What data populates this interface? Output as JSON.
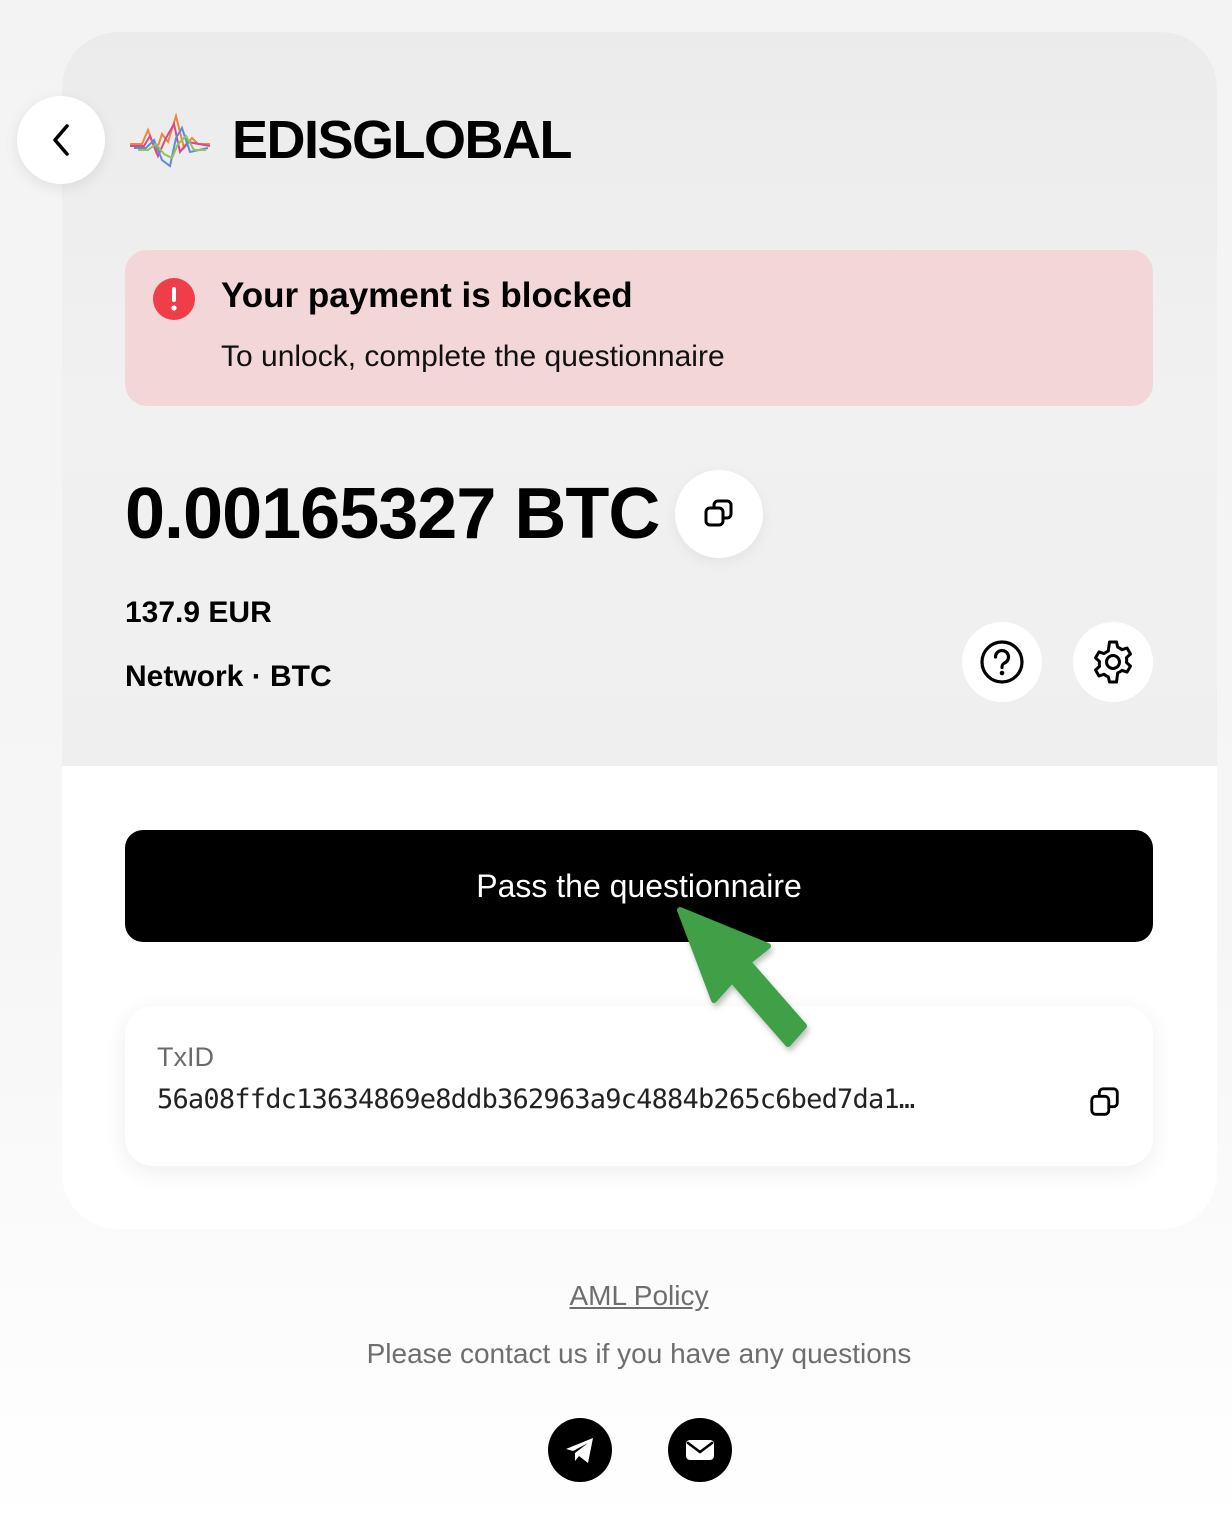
{
  "header": {
    "brand": "EDISGLOBAL",
    "back_icon": "chevron-left-icon",
    "logo_icon": "waveform-logo-icon"
  },
  "alert": {
    "title": "Your payment is blocked",
    "message": "To unlock, complete the questionnaire",
    "icon": "exclamation-circle-icon",
    "color": "#ef3d4a",
    "background": "#f2d6d8"
  },
  "payment": {
    "amount": "0.00165327 BTC",
    "fiat": "137.9 EUR",
    "network": "Network · BTC",
    "copy_icon": "copy-icon",
    "help_icon": "question-circle-icon",
    "settings_icon": "gear-icon"
  },
  "actions": {
    "primary_label": "Pass the questionnaire",
    "primary_color": "#000000"
  },
  "transaction": {
    "label": "TxID",
    "value": "56a08ffdc13634869e8ddb362963a9c4884b265c6bed7da1…",
    "copy_icon": "copy-icon"
  },
  "footer": {
    "aml_link": "AML Policy",
    "contact_text": "Please contact us if you have any questions",
    "telegram_icon": "telegram-icon",
    "email_icon": "email-icon"
  },
  "annotation": {
    "arrow_icon": "pointer-arrow-icon",
    "arrow_color": "#3fa046"
  }
}
